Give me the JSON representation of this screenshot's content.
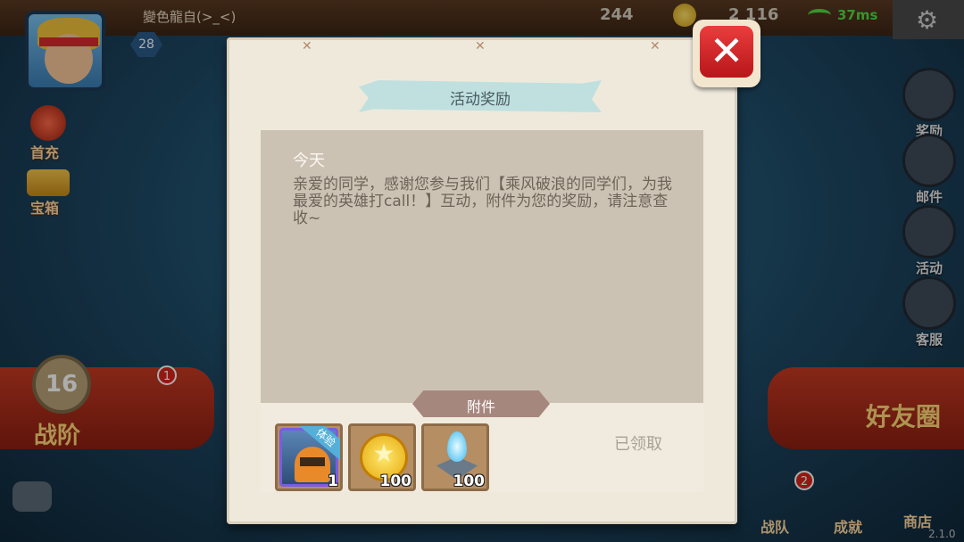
{
  "hud": {
    "player_name": "變色龍自(>_<)",
    "level": "28",
    "diamonds": "244",
    "coins": "2 116",
    "ping": "37ms",
    "first_recharge": "首充",
    "treasure": "宝箱",
    "rank_level": "16",
    "rank_label": "战阶",
    "rank_badge": "1",
    "friends": "好友圈",
    "version": "2.1.0",
    "right_menu": [
      {
        "label": "奖励"
      },
      {
        "label": "邮件"
      },
      {
        "label": "活动"
      },
      {
        "label": "客服"
      }
    ],
    "bottom_menu": [
      {
        "label": "战队",
        "badge": "2"
      },
      {
        "label": "成就"
      },
      {
        "label": "商店"
      }
    ]
  },
  "dialog": {
    "title": "活动奖励",
    "date": "今天",
    "body": "亲爱的同学，感谢您参与我们【乘风破浪的同学们，为我最爱的英雄打call！】互动，附件为您的奖励，请注意查收~",
    "attachments_label": "附件",
    "status": "已领取",
    "items": [
      {
        "icon": "hero-trial-icon",
        "tag": "体验",
        "count": "1"
      },
      {
        "icon": "gold-coin-icon",
        "count": "100"
      },
      {
        "icon": "blue-crystal-icon",
        "count": "100"
      }
    ],
    "close_icon": "close-icon"
  },
  "colors": {
    "dialog_bg": "#efe9dc",
    "content_bg": "#ccc2b4",
    "close_red": "#e02a2e",
    "ribbon": "#bfe0df"
  }
}
